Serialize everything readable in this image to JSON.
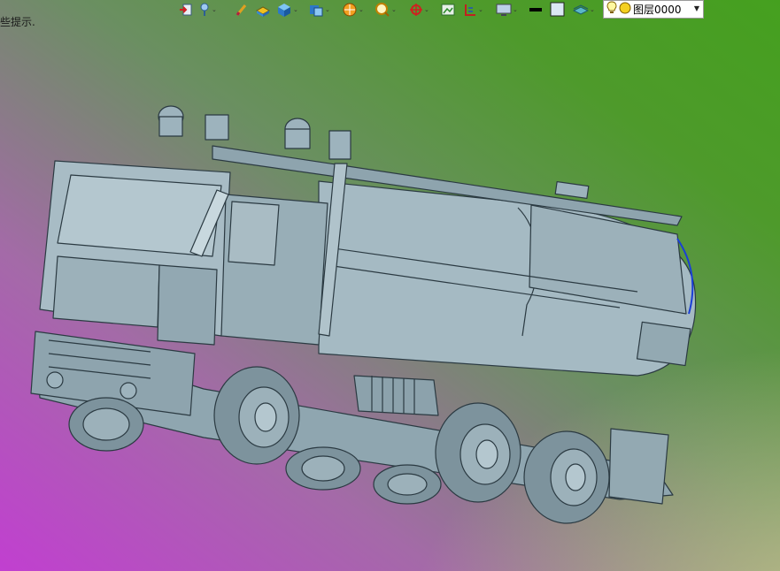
{
  "hint": {
    "text": "些提示."
  },
  "toolbar": {
    "buttons": [
      {
        "name": "view-orient-icon",
        "dropdown": false
      },
      {
        "name": "pointer-icon",
        "dropdown": true
      },
      {
        "name": "sketch-pen-icon",
        "dropdown": false
      },
      {
        "name": "cube-yellow-icon",
        "dropdown": false
      },
      {
        "name": "cube-blue-icon",
        "dropdown": true
      },
      {
        "name": "display-style-icon",
        "dropdown": true
      },
      {
        "name": "section-view-icon",
        "dropdown": true
      },
      {
        "name": "zoom-icon",
        "dropdown": true
      },
      {
        "name": "axis-icon",
        "dropdown": true
      },
      {
        "name": "image-icon",
        "dropdown": false
      },
      {
        "name": "ruler-icon",
        "dropdown": true
      },
      {
        "name": "monitor-icon",
        "dropdown": true
      },
      {
        "name": "line-width-icon",
        "dropdown": false
      },
      {
        "name": "color-swatch-icon",
        "dropdown": false
      },
      {
        "name": "layers-icon",
        "dropdown": true
      }
    ],
    "layer": {
      "label": "图层0000"
    }
  },
  "colors": {
    "model_fill": "#9db3bd",
    "model_stroke": "#2b3a42",
    "highlight_edge": "#1a3fd6"
  }
}
